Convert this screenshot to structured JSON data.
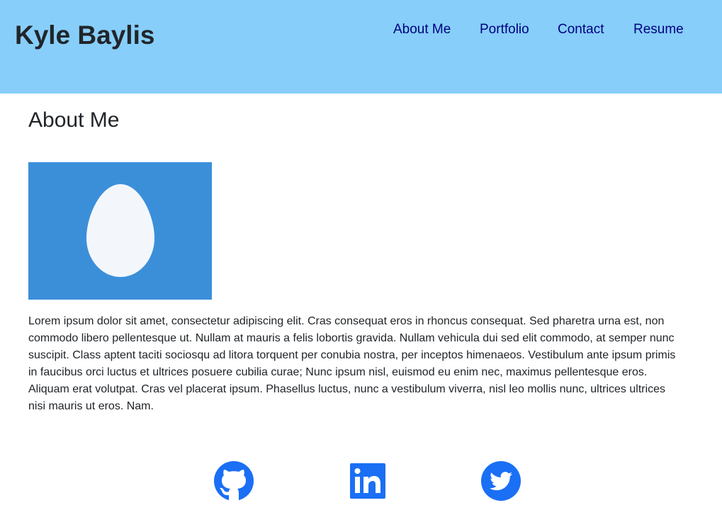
{
  "header": {
    "site_title": "Kyle Baylis",
    "nav": [
      {
        "label": "About Me"
      },
      {
        "label": "Portfolio"
      },
      {
        "label": "Contact"
      },
      {
        "label": "Resume"
      }
    ]
  },
  "main": {
    "section_title": "About Me",
    "photo_icon": "egg-avatar-icon",
    "bio": "Lorem ipsum dolor sit amet, consectetur adipiscing elit. Cras consequat eros in rhoncus consequat. Sed pharetra urna est, non commodo libero pellentesque ut. Nullam at mauris a felis lobortis gravida. Nullam vehicula dui sed elit commodo, at semper nunc suscipit. Class aptent taciti sociosqu ad litora torquent per conubia nostra, per inceptos himenaeos. Vestibulum ante ipsum primis in faucibus orci luctus et ultrices posuere cubilia curae; Nunc ipsum nisl, euismod eu enim nec, maximus pellentesque eros. Aliquam erat volutpat. Cras vel placerat ipsum. Phasellus luctus, nunc a vestibulum viverra, nisl leo mollis nunc, ultrices ultrices nisi mauris ut eros. Nam."
  },
  "social": {
    "icons": [
      "github-icon",
      "linkedin-icon",
      "twitter-icon"
    ]
  },
  "colors": {
    "header_bg": "#87cefa",
    "nav_link": "#000080",
    "photo_bg": "#3b8fd9",
    "egg": "#f3f7fc",
    "social_icon": "#1a6ff5"
  }
}
